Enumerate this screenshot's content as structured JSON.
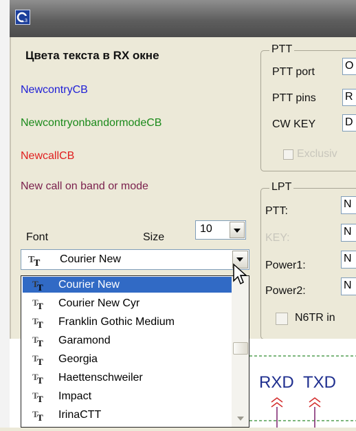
{
  "window": {
    "app_icon": "app-logo-icon"
  },
  "text_colors": {
    "heading": "Цвета текста в RX окне",
    "items": [
      {
        "label": "NewcontryCB",
        "color": "#1f1fd6"
      },
      {
        "label": "NewcontryonbandormodeCB",
        "color": "#1b8a1b"
      },
      {
        "label": "NewcallCB",
        "color": "#e01e1e"
      },
      {
        "label": "New call on band or mode",
        "color": "#7a1f4c"
      }
    ]
  },
  "font": {
    "font_label": "Font",
    "size_label": "Size",
    "size_value": "10",
    "selected": "Courier New",
    "options": [
      "Courier New",
      "Courier New Cyr",
      "Franklin Gothic Medium",
      "Garamond",
      "Georgia",
      "Haettenschweiler",
      "Impact",
      "IrinaCTT"
    ],
    "highlighted_index": 0
  },
  "ptt": {
    "title": "PTT",
    "port_label": "PTT port",
    "port_value": "O",
    "pins_label": "PTT pins",
    "pins_value": "R",
    "cwkey_label": "CW KEY",
    "cwkey_value": "D",
    "exclusive_label": "Exclusiv"
  },
  "lpt": {
    "title": "LPT",
    "ptt_label": "PTT:",
    "ptt_value": "N",
    "key_label": "KEY:",
    "key_value": "N",
    "power1_label": "Power1:",
    "power1_value": "N",
    "power2_label": "Power2:",
    "power2_value": "N",
    "n6tr_label": "N6TR in"
  },
  "diagram": {
    "rxd": "RXD",
    "txd": "TXD"
  },
  "colors": {
    "selection": "#316ac5",
    "disabled_text": "#c8c6bc",
    "diagram_line": "#2e8b2e"
  }
}
